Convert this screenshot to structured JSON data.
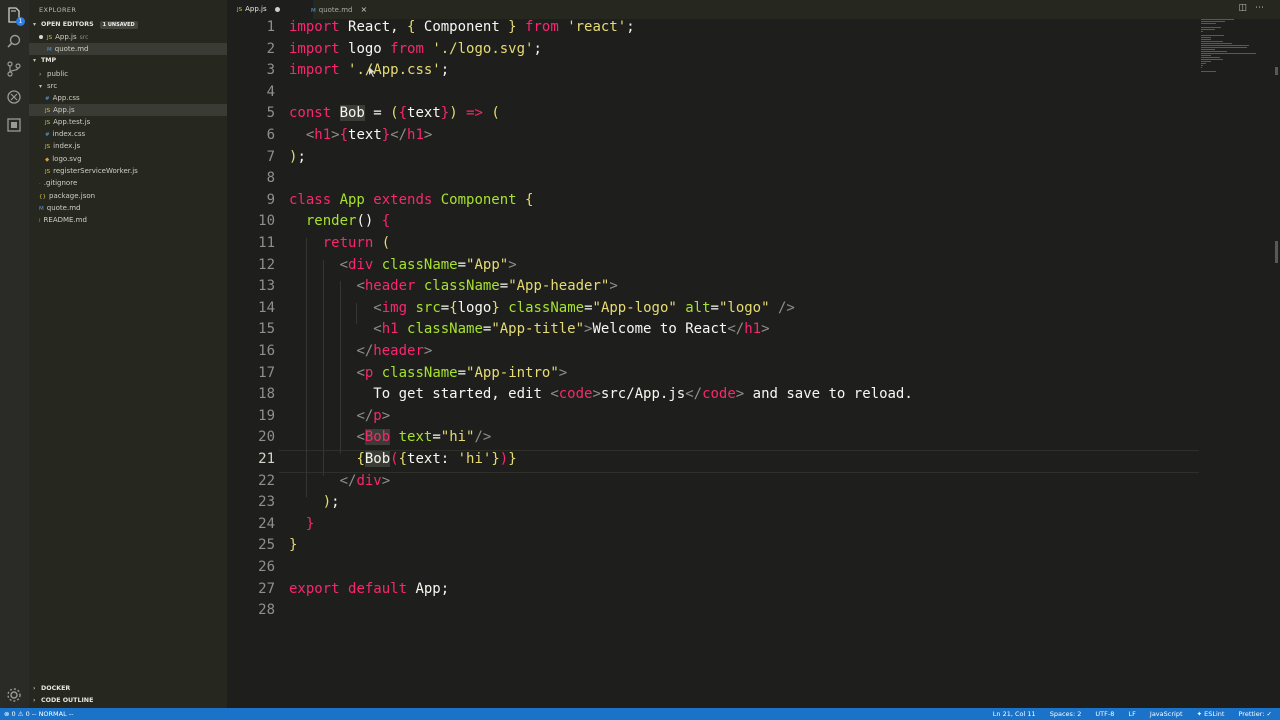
{
  "sidebar": {
    "title": "EXPLORER",
    "open_editors": {
      "label": "OPEN EDITORS",
      "badge": "1 UNSAVED",
      "items": [
        {
          "name": "App.js",
          "folder": "src",
          "icon": "JS",
          "dirty": true
        },
        {
          "name": "quote.md",
          "folder": "",
          "icon": "M",
          "dirty": false
        }
      ]
    },
    "workspace": {
      "label": "TMP",
      "items": [
        {
          "name": "public",
          "type": "folder",
          "depth": 1,
          "open": false
        },
        {
          "name": "src",
          "type": "folder",
          "depth": 1,
          "open": true
        },
        {
          "name": "App.css",
          "type": "css",
          "depth": 2,
          "icon": "#"
        },
        {
          "name": "App.js",
          "type": "js",
          "depth": 2,
          "icon": "JS",
          "active": true
        },
        {
          "name": "App.test.js",
          "type": "js",
          "depth": 2,
          "icon": "JS"
        },
        {
          "name": "index.css",
          "type": "css",
          "depth": 2,
          "icon": "#"
        },
        {
          "name": "index.js",
          "type": "js",
          "depth": 2,
          "icon": "JS"
        },
        {
          "name": "logo.svg",
          "type": "svg",
          "depth": 2,
          "icon": "◆"
        },
        {
          "name": "registerServiceWorker.js",
          "type": "js",
          "depth": 2,
          "icon": "JS"
        },
        {
          "name": ".gitignore",
          "type": "file",
          "depth": 1,
          "icon": "·"
        },
        {
          "name": "package.json",
          "type": "json",
          "depth": 1,
          "icon": "{}"
        },
        {
          "name": "quote.md",
          "type": "md",
          "depth": 1,
          "icon": "M"
        },
        {
          "name": "README.md",
          "type": "md",
          "depth": 1,
          "icon": "i"
        }
      ]
    },
    "docker_label": "DOCKER",
    "outline_label": "CODE OUTLINE"
  },
  "tabs": [
    {
      "label": "App.js",
      "icon": "JS",
      "active": true,
      "dirty": true
    },
    {
      "label": "quote.md",
      "icon": "M",
      "active": false,
      "dirty": false
    }
  ],
  "editor": {
    "current_line": 21,
    "lines": [
      [
        [
          "import ",
          "kw"
        ],
        [
          "React",
          "id"
        ],
        [
          ", ",
          "p"
        ],
        [
          "{ ",
          "br"
        ],
        [
          "Component",
          "id"
        ],
        [
          " }",
          "br"
        ],
        [
          " from ",
          "kw"
        ],
        [
          "'react'",
          "str"
        ],
        [
          ";",
          "p"
        ]
      ],
      [
        [
          "import ",
          "kw"
        ],
        [
          "logo",
          "id"
        ],
        [
          " from ",
          "kw"
        ],
        [
          "'./logo.svg'",
          "str"
        ],
        [
          ";",
          "p"
        ]
      ],
      [
        [
          "import ",
          "kw"
        ],
        [
          "'./App.css'",
          "str"
        ],
        [
          ";",
          "p"
        ]
      ],
      [],
      [
        [
          "const ",
          "kw"
        ],
        [
          "Bob",
          "idhl"
        ],
        [
          " = ",
          "p"
        ],
        [
          "(",
          "br"
        ],
        [
          "{",
          "br2"
        ],
        [
          "text",
          "id"
        ],
        [
          "}",
          "br2"
        ],
        [
          ")",
          "br"
        ],
        [
          " => ",
          "kw"
        ],
        [
          "(",
          "br"
        ]
      ],
      [
        [
          "  ",
          "p"
        ],
        [
          "<",
          "tagp"
        ],
        [
          "h1",
          "tag"
        ],
        [
          ">",
          "tagp"
        ],
        [
          "{",
          "br2"
        ],
        [
          "text",
          "id"
        ],
        [
          "}",
          "br2"
        ],
        [
          "</",
          "tagp"
        ],
        [
          "h1",
          "tag"
        ],
        [
          ">",
          "tagp"
        ]
      ],
      [
        [
          ")",
          "br"
        ],
        [
          ";",
          "p"
        ]
      ],
      [],
      [
        [
          "class ",
          "kw"
        ],
        [
          "App",
          "cls"
        ],
        [
          " extends ",
          "kw"
        ],
        [
          "Component",
          "cls"
        ],
        [
          " {",
          "br"
        ]
      ],
      [
        [
          "  ",
          "p"
        ],
        [
          "render",
          "fn"
        ],
        [
          "() ",
          "p"
        ],
        [
          "{",
          "br2"
        ]
      ],
      [
        [
          "    ",
          "p"
        ],
        [
          "return ",
          "kw"
        ],
        [
          "(",
          "br"
        ]
      ],
      [
        [
          "      ",
          "p"
        ],
        [
          "<",
          "tagp"
        ],
        [
          "div",
          "tag"
        ],
        [
          " className",
          "attr"
        ],
        [
          "=",
          "p"
        ],
        [
          "\"App\"",
          "str"
        ],
        [
          ">",
          "tagp"
        ]
      ],
      [
        [
          "        ",
          "p"
        ],
        [
          "<",
          "tagp"
        ],
        [
          "header",
          "tag"
        ],
        [
          " className",
          "attr"
        ],
        [
          "=",
          "p"
        ],
        [
          "\"App-header\"",
          "str"
        ],
        [
          ">",
          "tagp"
        ]
      ],
      [
        [
          "          ",
          "p"
        ],
        [
          "<",
          "tagp"
        ],
        [
          "img",
          "tag"
        ],
        [
          " src",
          "attr"
        ],
        [
          "=",
          "p"
        ],
        [
          "{",
          "br"
        ],
        [
          "logo",
          "id"
        ],
        [
          "}",
          "br"
        ],
        [
          " className",
          "attr"
        ],
        [
          "=",
          "p"
        ],
        [
          "\"App-logo\"",
          "str"
        ],
        [
          " alt",
          "attr"
        ],
        [
          "=",
          "p"
        ],
        [
          "\"logo\"",
          "str"
        ],
        [
          " />",
          "tagp"
        ]
      ],
      [
        [
          "          ",
          "p"
        ],
        [
          "<",
          "tagp"
        ],
        [
          "h1",
          "tag"
        ],
        [
          " className",
          "attr"
        ],
        [
          "=",
          "p"
        ],
        [
          "\"App-title\"",
          "str"
        ],
        [
          ">",
          "tagp"
        ],
        [
          "Welcome to React",
          "p"
        ],
        [
          "</",
          "tagp"
        ],
        [
          "h1",
          "tag"
        ],
        [
          ">",
          "tagp"
        ]
      ],
      [
        [
          "        ",
          "p"
        ],
        [
          "</",
          "tagp"
        ],
        [
          "header",
          "tag"
        ],
        [
          ">",
          "tagp"
        ]
      ],
      [
        [
          "        ",
          "p"
        ],
        [
          "<",
          "tagp"
        ],
        [
          "p",
          "tag"
        ],
        [
          " className",
          "attr"
        ],
        [
          "=",
          "p"
        ],
        [
          "\"App-intro\"",
          "str"
        ],
        [
          ">",
          "tagp"
        ]
      ],
      [
        [
          "          ",
          "p"
        ],
        [
          "To get started, edit ",
          "p"
        ],
        [
          "<",
          "tagp"
        ],
        [
          "code",
          "tag"
        ],
        [
          ">",
          "tagp"
        ],
        [
          "src/App.js",
          "p"
        ],
        [
          "</",
          "tagp"
        ],
        [
          "code",
          "tag"
        ],
        [
          ">",
          "tagp"
        ],
        [
          " and save to reload.",
          "p"
        ]
      ],
      [
        [
          "        ",
          "p"
        ],
        [
          "</",
          "tagp"
        ],
        [
          "p",
          "tag"
        ],
        [
          ">",
          "tagp"
        ]
      ],
      [
        [
          "        ",
          "p"
        ],
        [
          "<",
          "tagp"
        ],
        [
          "Bob",
          "taghl"
        ],
        [
          " text",
          "attr"
        ],
        [
          "=",
          "p"
        ],
        [
          "\"hi\"",
          "str"
        ],
        [
          "/>",
          "tagp"
        ]
      ],
      [
        [
          "        ",
          "p"
        ],
        [
          "{",
          "br"
        ],
        [
          "Bob",
          "idhl"
        ],
        [
          "(",
          "br2"
        ],
        [
          "{",
          "br"
        ],
        [
          "text: ",
          "id"
        ],
        [
          "'hi'",
          "str"
        ],
        [
          "}",
          "br"
        ],
        [
          ")",
          "br2"
        ],
        [
          "}",
          "br"
        ]
      ],
      [
        [
          "      ",
          "p"
        ],
        [
          "</",
          "tagp"
        ],
        [
          "div",
          "tag"
        ],
        [
          ">",
          "tagp"
        ]
      ],
      [
        [
          "    ",
          "p"
        ],
        [
          ")",
          "br"
        ],
        [
          ";",
          "p"
        ]
      ],
      [
        [
          "  ",
          "p"
        ],
        [
          "}",
          "br2"
        ]
      ],
      [
        [
          "}",
          "br"
        ]
      ],
      [],
      [
        [
          "export ",
          "kw"
        ],
        [
          "default ",
          "kw"
        ],
        [
          "App",
          "id"
        ],
        [
          ";",
          "p"
        ]
      ],
      []
    ]
  },
  "status": {
    "left": "⊗ 0 ⚠ 0  -- NORMAL --",
    "position": "Ln 21, Col 11",
    "spaces": "Spaces: 2",
    "encoding": "UTF-8",
    "eol": "LF",
    "language": "JavaScript",
    "eslint": "✦ ESLint",
    "prettier": "Prettier: ✓"
  },
  "colors": {
    "kw": "#f92672",
    "id": "#f8f8f2",
    "str": "#e6db74",
    "p": "#f8f8f2",
    "br": "#e6db74",
    "br2": "#f92672",
    "tag": "#f92672",
    "tagp": "#8f908a",
    "attr": "#a6e22e",
    "cls": "#a6e22e",
    "fn": "#a6e22e",
    "idhl": "#f8f8f2",
    "taghl": "#f92672",
    "status_bg": "#1a73c8"
  }
}
